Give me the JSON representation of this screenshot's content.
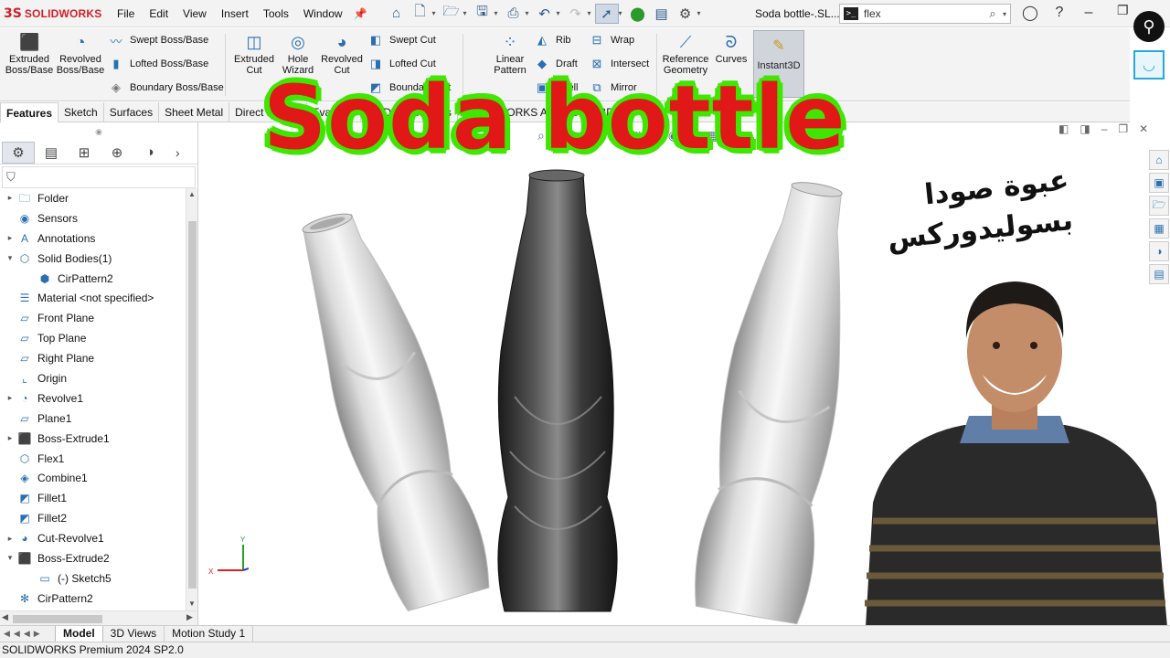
{
  "app": {
    "logo_mark": "3S",
    "logo_text": "SOLIDWORKS",
    "menu": [
      "File",
      "Edit",
      "View",
      "Insert",
      "Tools",
      "Window"
    ],
    "document_title": "Soda bottle-.SL...",
    "search": {
      "value": "flex"
    }
  },
  "ribbon": {
    "extruded_boss": "Extruded Boss/Base",
    "revolved_boss": "Revolved Boss/Base",
    "swept_boss": "Swept Boss/Base",
    "lofted_boss": "Lofted Boss/Base",
    "boundary_boss": "Boundary Boss/Base",
    "extruded_cut": "Extruded Cut",
    "hole_wizard": "Hole Wizard",
    "revolved_cut": "Revolved Cut",
    "swept_cut": "Swept Cut",
    "lofted_cut": "Lofted Cut",
    "boundary_cut": "Boundary Cut",
    "linear_pattern": "Linear Pattern",
    "rib": "Rib",
    "draft": "Draft",
    "shell": "Shell",
    "wrap": "Wrap",
    "intersect": "Intersect",
    "mirror": "Mirror",
    "reference_geometry": "Reference Geometry",
    "curves": "Curves",
    "instant3d": "Instant3D"
  },
  "command_tabs": [
    "Features",
    "Sketch",
    "Surfaces",
    "Sheet Metal",
    "Direct Editing",
    "Evaluate",
    "MBD Dimensions",
    "SOLIDWORKS Add-Ins",
    "MBD"
  ],
  "feature_tree": [
    {
      "label": "Folder",
      "icon": "folder-icon",
      "expand": "▸",
      "indent": 0
    },
    {
      "label": "Sensors",
      "icon": "sensor-icon",
      "expand": "",
      "indent": 0
    },
    {
      "label": "Annotations",
      "icon": "annotation-icon",
      "expand": "▸",
      "indent": 0
    },
    {
      "label": "Solid Bodies(1)",
      "icon": "solid-bodies-icon",
      "expand": "▾",
      "indent": 0
    },
    {
      "label": "CirPattern2",
      "icon": "body-icon",
      "expand": "",
      "indent": 1
    },
    {
      "label": "Material <not specified>",
      "icon": "material-icon",
      "expand": "",
      "indent": 0
    },
    {
      "label": "Front Plane",
      "icon": "plane-icon",
      "expand": "",
      "indent": 0
    },
    {
      "label": "Top Plane",
      "icon": "plane-icon",
      "expand": "",
      "indent": 0
    },
    {
      "label": "Right Plane",
      "icon": "plane-icon",
      "expand": "",
      "indent": 0
    },
    {
      "label": "Origin",
      "icon": "origin-icon",
      "expand": "",
      "indent": 0
    },
    {
      "label": "Revolve1",
      "icon": "revolve-icon",
      "expand": "▸",
      "indent": 0
    },
    {
      "label": "Plane1",
      "icon": "plane-icon",
      "expand": "",
      "indent": 0
    },
    {
      "label": "Boss-Extrude1",
      "icon": "extrude-icon",
      "expand": "▸",
      "indent": 0
    },
    {
      "label": "Flex1",
      "icon": "flex-icon",
      "expand": "",
      "indent": 0
    },
    {
      "label": "Combine1",
      "icon": "combine-icon",
      "expand": "",
      "indent": 0
    },
    {
      "label": "Fillet1",
      "icon": "fillet-icon",
      "expand": "",
      "indent": 0
    },
    {
      "label": "Fillet2",
      "icon": "fillet-icon",
      "expand": "",
      "indent": 0
    },
    {
      "label": "Cut-Revolve1",
      "icon": "cut-revolve-icon",
      "expand": "▸",
      "indent": 0
    },
    {
      "label": "Boss-Extrude2",
      "icon": "extrude-icon",
      "expand": "▾",
      "indent": 0
    },
    {
      "label": "(-) Sketch5",
      "icon": "sketch-icon",
      "expand": "",
      "indent": 1
    },
    {
      "label": "CirPattern2",
      "icon": "circular-pattern-icon",
      "expand": "",
      "indent": 0
    }
  ],
  "bottom_tabs": [
    "Model",
    "3D Views",
    "Motion Study 1"
  ],
  "status_text": "SOLIDWORKS Premium 2024 SP2.0",
  "overlay": {
    "title": "Soda bottle",
    "subtitle": "عبوة صودا بسوليدوركس"
  },
  "triad": {
    "y": "Y",
    "x": "X"
  },
  "colors": {
    "accent": "#d0202a",
    "title_red": "#e01818",
    "title_outline": "#3ee600"
  }
}
